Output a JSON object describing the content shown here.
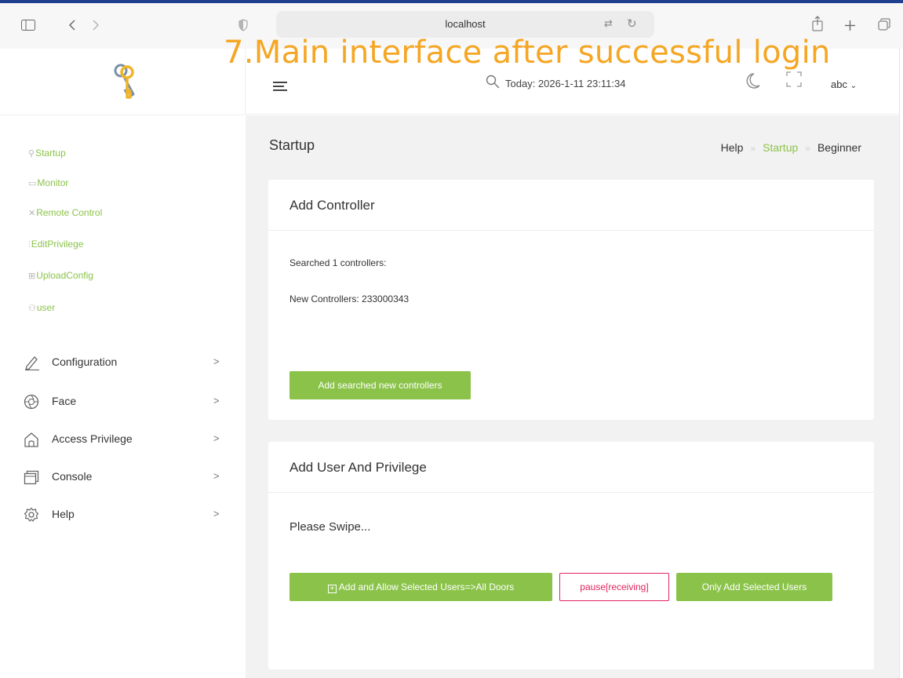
{
  "browser": {
    "url": "localhost"
  },
  "caption": "7.Main interface after successful login",
  "sidebar": {
    "quick_links": [
      {
        "label": "Startup"
      },
      {
        "label": "Monitor"
      },
      {
        "label": "Remote Control"
      },
      {
        "label": "EditPrivilege"
      },
      {
        "label": "UploadConfig"
      },
      {
        "label": "user"
      }
    ],
    "menu": [
      {
        "label": "Configuration",
        "icon": "pencil-icon"
      },
      {
        "label": "Face",
        "icon": "aperture-icon"
      },
      {
        "label": "Access Privilege",
        "icon": "home-icon"
      },
      {
        "label": "Console",
        "icon": "windows-icon"
      },
      {
        "label": "Help",
        "icon": "gear-icon"
      }
    ]
  },
  "header": {
    "today": "Today: 2026-1-11 23:11:34",
    "user": "abc"
  },
  "page": {
    "title": "Startup",
    "breadcrumb": [
      "Help",
      "Startup",
      "Beginner"
    ]
  },
  "add_controller": {
    "title": "Add Controller",
    "searched": "Searched 1 controllers:",
    "new_controllers": "New Controllers: 233000343",
    "button": "Add searched new controllers"
  },
  "add_user": {
    "title": "Add User And Privilege",
    "status": "Please Swipe...",
    "add_allow_button": "Add and Allow Selected Users=>All Doors",
    "pause_button": "pause[receiving]",
    "only_add_button": "Only Add Selected Users"
  },
  "colors": {
    "accent_green": "#8bc34a",
    "danger_pink": "#e0245e",
    "caption_orange": "#f5a623"
  }
}
